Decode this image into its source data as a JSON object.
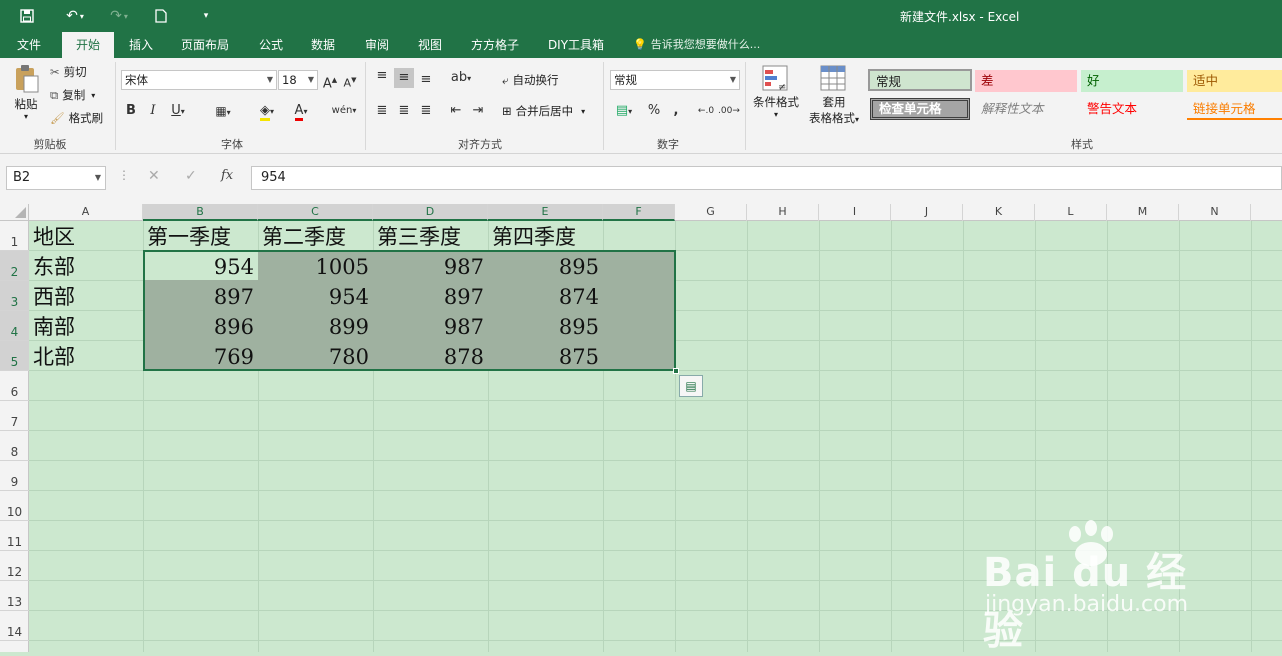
{
  "colors": {
    "accent": "#217346",
    "sheet_bg": "#cce8cf",
    "selection_fill": "#9fb1a0"
  },
  "titlebar": {
    "title": "新建文件.xlsx - Excel",
    "icons": [
      "save-icon",
      "undo-icon",
      "redo-icon",
      "new-file-icon",
      "customize-icon"
    ]
  },
  "tabs": [
    {
      "label": "文件"
    },
    {
      "label": "开始"
    },
    {
      "label": "插入"
    },
    {
      "label": "页面布局"
    },
    {
      "label": "公式"
    },
    {
      "label": "数据"
    },
    {
      "label": "审阅"
    },
    {
      "label": "视图"
    },
    {
      "label": "方方格子"
    },
    {
      "label": "DIY工具箱"
    }
  ],
  "tell_me": "告诉我您想要做什么...",
  "ribbon": {
    "clipboard": {
      "paste": "粘贴",
      "cut": "剪切",
      "copy": "复制",
      "format_painter": "格式刷",
      "group": "剪贴板"
    },
    "font": {
      "name": "宋体",
      "size": "18",
      "bold": "B",
      "italic": "I",
      "underline": "U",
      "color": "A",
      "grow": "A",
      "shrink": "A",
      "group": "字体"
    },
    "alignment": {
      "wrap": "自动换行",
      "merge": "合并后居中",
      "group": "对齐方式"
    },
    "number": {
      "format": "常规",
      "percent": "%",
      "comma": ",",
      "group": "数字"
    },
    "cond_format": "条件格式",
    "table_format_1": "套用",
    "table_format_2": "表格格式",
    "styles": {
      "group": "样式",
      "normal": "常规",
      "bad": "差",
      "good": "好",
      "neutral": "适中",
      "check": "检查单元格",
      "explanatory": "解释性文本",
      "warning": "警告文本",
      "linked": "链接单元格"
    }
  },
  "formula_bar": {
    "name_box": "B2",
    "fx": "fx",
    "value": "954"
  },
  "columns": [
    "A",
    "B",
    "C",
    "D",
    "E",
    "F",
    "G",
    "H",
    "I",
    "J",
    "K",
    "L",
    "M",
    "N"
  ],
  "rows": [
    "1",
    "2",
    "3",
    "4",
    "5",
    "6",
    "7",
    "8",
    "9",
    "10",
    "11",
    "12",
    "13",
    "14"
  ],
  "sheet": {
    "header": [
      "地区",
      "第一季度",
      "第二季度",
      "第三季度",
      "第四季度"
    ],
    "data": [
      {
        "region": "东部",
        "q1": "954",
        "q2": "1005",
        "q3": "987",
        "q4": "895"
      },
      {
        "region": "西部",
        "q1": "897",
        "q2": "954",
        "q3": "897",
        "q4": "874"
      },
      {
        "region": "南部",
        "q1": "896",
        "q2": "899",
        "q3": "987",
        "q4": "895"
      },
      {
        "region": "北部",
        "q1": "769",
        "q2": "780",
        "q3": "878",
        "q4": "875"
      }
    ]
  },
  "watermark": {
    "brand": "Bai du 经验",
    "url": "jingyan.baidu.com"
  }
}
